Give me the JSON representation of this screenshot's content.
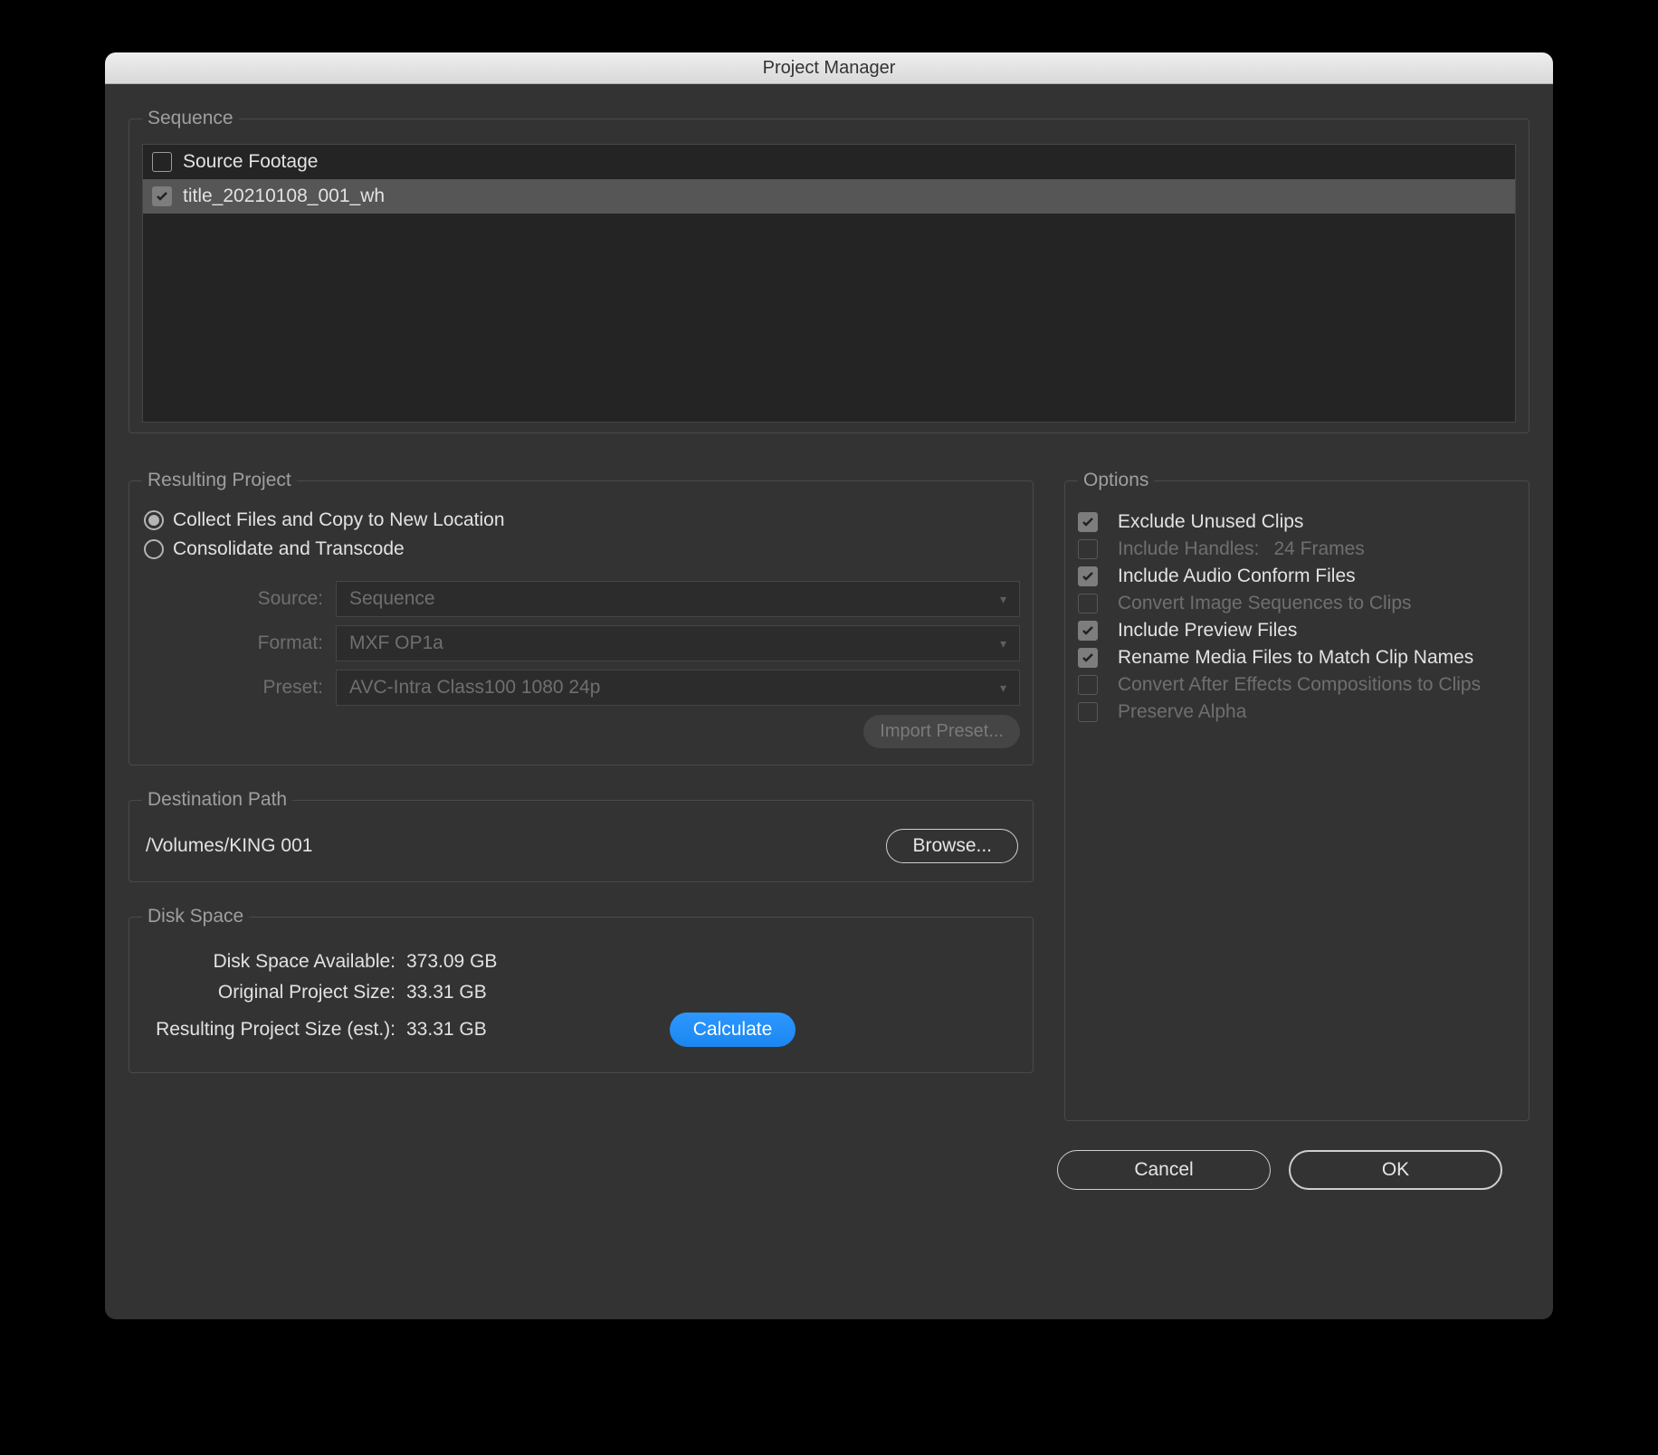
{
  "window": {
    "title": "Project Manager"
  },
  "sequence": {
    "legend": "Sequence",
    "items": [
      {
        "label": "Source Footage",
        "checked": false,
        "selected": false
      },
      {
        "label": "title_20210108_001_wh",
        "checked": true,
        "selected": true
      }
    ]
  },
  "resulting": {
    "legend": "Resulting Project",
    "radios": {
      "collect": "Collect Files and Copy to New Location",
      "transcode": "Consolidate and Transcode",
      "selected": "collect"
    },
    "source_label": "Source:",
    "source_value": "Sequence",
    "format_label": "Format:",
    "format_value": "MXF OP1a",
    "preset_label": "Preset:",
    "preset_value": "AVC-Intra Class100 1080 24p",
    "import_preset": "Import Preset..."
  },
  "options": {
    "legend": "Options",
    "items": [
      {
        "label": "Exclude Unused Clips",
        "checked": true,
        "enabled": true
      },
      {
        "label": "Include Handles:",
        "suffix": "24 Frames",
        "checked": false,
        "enabled": false
      },
      {
        "label": "Include Audio Conform Files",
        "checked": true,
        "enabled": true
      },
      {
        "label": "Convert Image Sequences to Clips",
        "checked": false,
        "enabled": false
      },
      {
        "label": "Include Preview Files",
        "checked": true,
        "enabled": true
      },
      {
        "label": "Rename Media Files to Match Clip Names",
        "checked": true,
        "enabled": true
      },
      {
        "label": "Convert After Effects Compositions to Clips",
        "checked": false,
        "enabled": false
      },
      {
        "label": "Preserve Alpha",
        "checked": false,
        "enabled": false
      }
    ]
  },
  "destination": {
    "legend": "Destination Path",
    "path": "/Volumes/KING 001",
    "browse": "Browse..."
  },
  "disk": {
    "legend": "Disk Space",
    "available_label": "Disk Space Available:",
    "available_value": "373.09 GB",
    "original_label": "Original Project Size:",
    "original_value": "33.31 GB",
    "resulting_label": "Resulting Project Size (est.):",
    "resulting_value": "33.31 GB",
    "calculate": "Calculate"
  },
  "footer": {
    "cancel": "Cancel",
    "ok": "OK"
  }
}
